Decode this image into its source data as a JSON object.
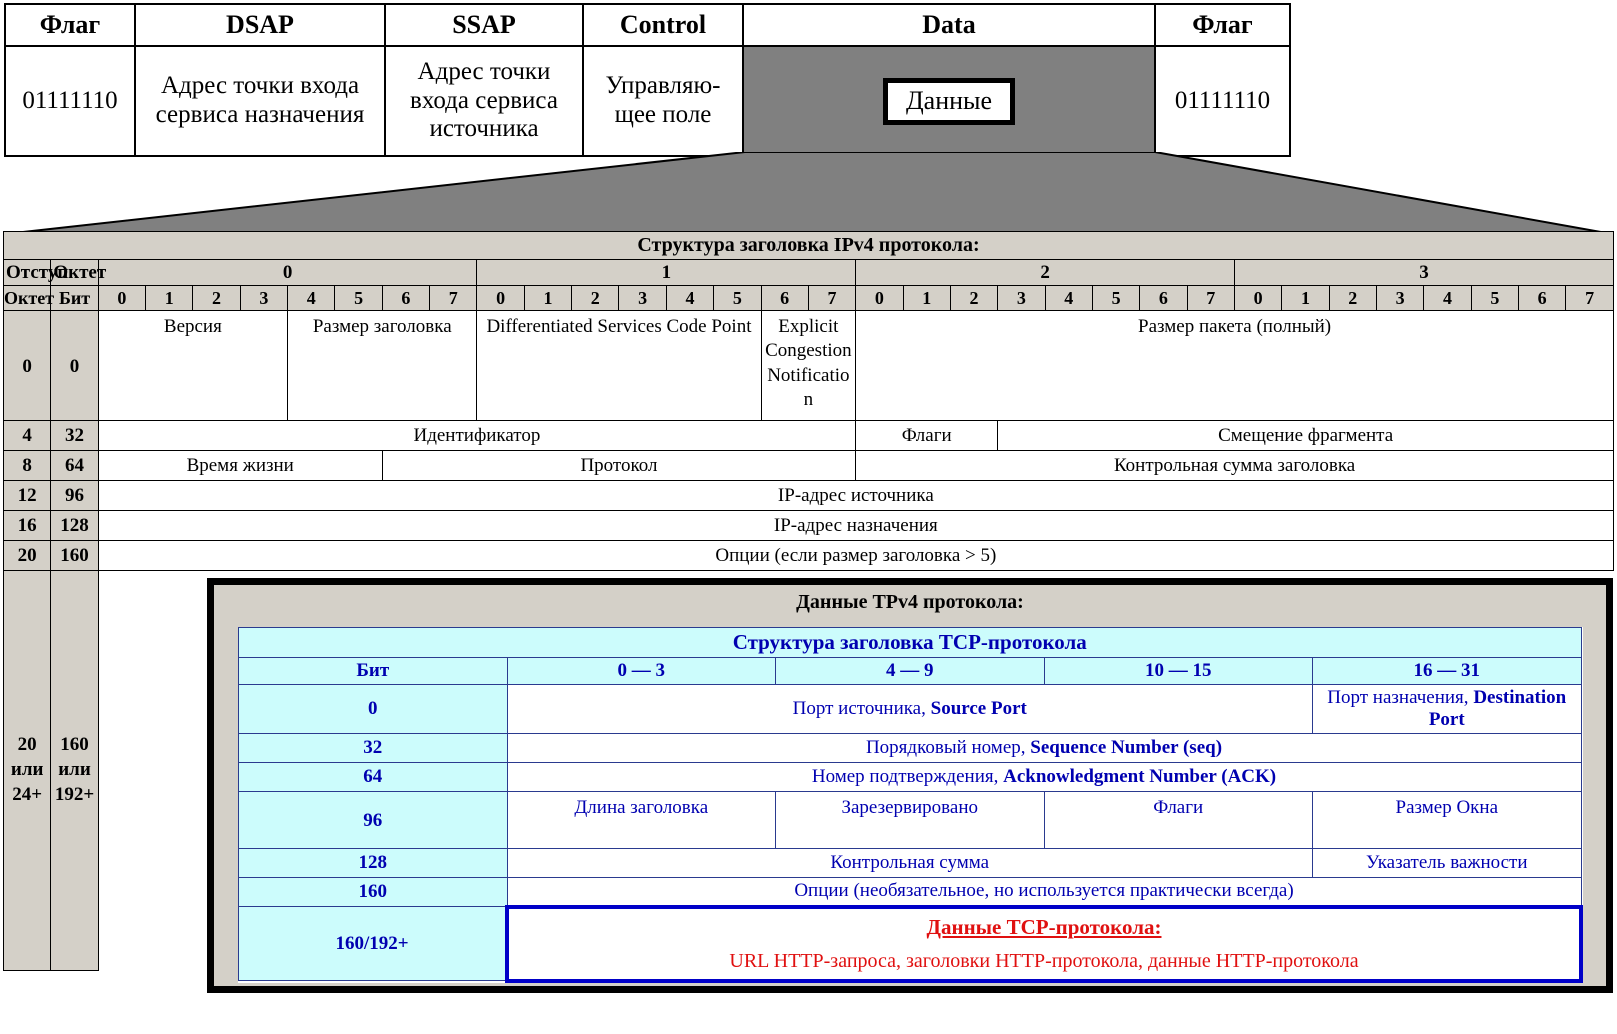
{
  "llc_frame": {
    "headers": [
      "Флаг",
      "DSAP",
      "SSAP",
      "Control",
      "Data",
      "Флаг"
    ],
    "cells": {
      "flag_left": "01111110",
      "dsap": "Адрес точки входа сервиса назначения",
      "ssap": "Адрес точки входа сервиса источника",
      "control": "Управляю-щее поле",
      "data_chip": "Данные",
      "flag_right": "01111110"
    },
    "colors": {
      "data_fill": "#808080"
    }
  },
  "ipv4": {
    "title": "Структура заголовка IPv4 протокола:",
    "corner_headers": {
      "offset": "Отступ",
      "octet": "Октет",
      "octet2": "Октет",
      "bit": "Бит"
    },
    "octet_groups": [
      "0",
      "1",
      "2",
      "3"
    ],
    "bit_numbers": [
      "0",
      "1",
      "2",
      "3",
      "4",
      "5",
      "6",
      "7",
      "0",
      "1",
      "2",
      "3",
      "4",
      "5",
      "6",
      "7",
      "0",
      "1",
      "2",
      "3",
      "4",
      "5",
      "6",
      "7",
      "0",
      "1",
      "2",
      "3",
      "4",
      "5",
      "6",
      "7"
    ],
    "rows": [
      {
        "offset": "0",
        "bit": "0",
        "fields": [
          "Версия",
          "Размер заголовка",
          "Differentiated Services Code Point",
          "Explicit Congestion Notificatio n",
          "Размер пакета (полный)"
        ]
      },
      {
        "offset": "4",
        "bit": "32",
        "fields": [
          "Идентификатор",
          "Флаги",
          "Смещение фрагмента"
        ]
      },
      {
        "offset": "8",
        "bit": "64",
        "fields": [
          "Время жизни",
          "Протокол",
          "Контрольная сумма заголовка"
        ]
      },
      {
        "offset": "12",
        "bit": "96",
        "fields": [
          "IP-адрес источника"
        ]
      },
      {
        "offset": "16",
        "bit": "128",
        "fields": [
          "IP-адрес назначения"
        ]
      },
      {
        "offset": "20",
        "bit": "160",
        "fields": [
          "Опции (если размер заголовка > 5)"
        ]
      }
    ],
    "last_row": {
      "offset": "20 или 24+",
      "bit": "160 или 192+"
    }
  },
  "tcp": {
    "section_title": "Данные TPv4 протокола:",
    "table_title": "Структура заголовка TCP-протокола",
    "col_headers": [
      "Бит",
      "0 — 3",
      "4 — 9",
      "10 — 15",
      "16 — 31"
    ],
    "rows": [
      {
        "bit": "0",
        "cells": [
          {
            "ru": "Порт источника, ",
            "en": "Source Port",
            "span": 3
          },
          {
            "ru": "Порт назначения, ",
            "en": "Destination Port",
            "span": 1
          }
        ]
      },
      {
        "bit": "32",
        "cells": [
          {
            "ru": "Порядковый номер, ",
            "en": "Sequence Number (seq)",
            "span": 4
          }
        ]
      },
      {
        "bit": "64",
        "cells": [
          {
            "ru": "Номер подтверждения, ",
            "en": "Acknowledgment Number (ACK)",
            "span": 4
          }
        ]
      },
      {
        "bit": "96",
        "cells": [
          {
            "ru": "Длина заголовка",
            "en": "",
            "span": 1
          },
          {
            "ru": "Зарезервировано",
            "en": "",
            "span": 1
          },
          {
            "ru": "Флаги",
            "en": "",
            "span": 1
          },
          {
            "ru": "Размер Окна",
            "en": "",
            "span": 1
          }
        ]
      },
      {
        "bit": "128",
        "cells": [
          {
            "ru": "Контрольная сумма",
            "en": "",
            "span": 3
          },
          {
            "ru": "Указатель важности",
            "en": "",
            "span": 1
          }
        ]
      },
      {
        "bit": "160",
        "cells": [
          {
            "ru": "Опции (необязательное, но используется практически всегда)",
            "en": "",
            "span": 4
          }
        ]
      }
    ],
    "payload": {
      "bit": "160/192+",
      "heading": "Данные TCP-протокола:",
      "body": "URL HTTP-запроса, заголовки HTTP-протокола, данные HTTP-протокола"
    },
    "colors": {
      "cyan": "#ccfcfc",
      "text": "#0000b0",
      "red": "#e01010",
      "box": "#0000c8"
    }
  }
}
